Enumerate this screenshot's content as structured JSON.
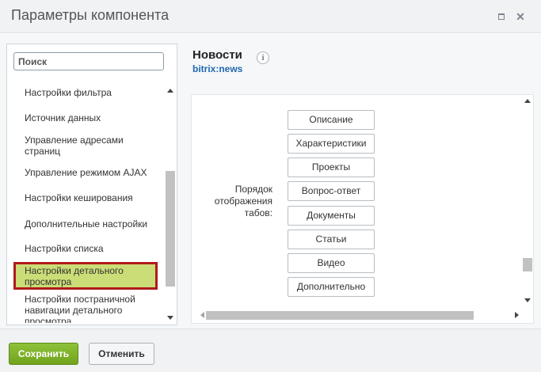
{
  "window": {
    "title": "Параметры компонента",
    "maximize_icon": "maximize-icon",
    "close_icon": "close-icon",
    "close_glyph": "✕"
  },
  "sidebar": {
    "search_placeholder": "Поиск",
    "items": [
      {
        "label": "Настройки фильтра"
      },
      {
        "label": "Источник данных"
      },
      {
        "label": "Управление адресами страниц"
      },
      {
        "label": "Управление режимом AJAX"
      },
      {
        "label": "Настройки кеширования"
      },
      {
        "label": "Дополнительные настройки"
      },
      {
        "label": "Настройки списка"
      },
      {
        "label": "Настройки детального просмотра",
        "selected": true
      },
      {
        "label": "Настройки постраничной навигации детального просмотра"
      }
    ]
  },
  "component": {
    "name": "Новости",
    "code": "bitrix:news",
    "info_glyph": "i"
  },
  "property": {
    "label": "Порядок отображения табов:",
    "tabs": [
      "Описание",
      "Характеристики",
      "Проекты",
      "Вопрос-ответ",
      "Документы",
      "Статьи",
      "Видео",
      "Дополнительно"
    ]
  },
  "footer": {
    "save_label": "Сохранить",
    "cancel_label": "Отменить"
  },
  "colors": {
    "save_button": "#7ab02a",
    "selected_item_bg": "#cbdd76",
    "selected_item_border": "#b01b1b",
    "component_code": "#2067b0"
  }
}
